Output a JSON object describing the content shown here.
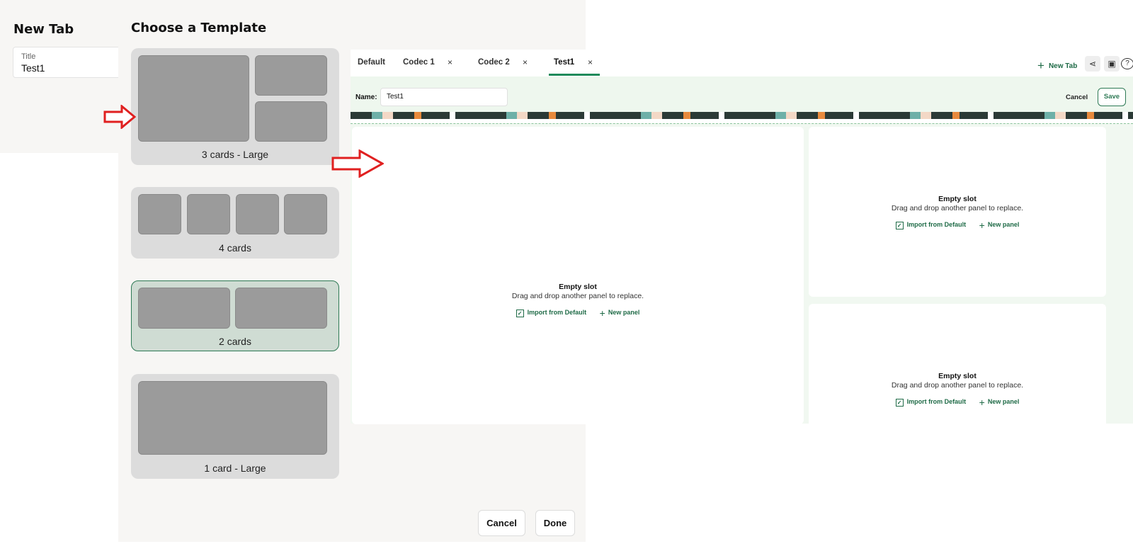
{
  "new_tab_panel": {
    "heading": "New Tab",
    "title_field": {
      "label": "Title",
      "value": "Test1"
    }
  },
  "template_chooser": {
    "heading": "Choose a Template",
    "templates": [
      {
        "caption": "3 cards - Large",
        "selected": false
      },
      {
        "caption": "4 cards",
        "selected": false
      },
      {
        "caption": "2 cards",
        "selected": true
      },
      {
        "caption": "1 card - Large",
        "selected": false
      }
    ],
    "cancel_label": "Cancel",
    "done_label": "Done"
  },
  "editor": {
    "tabs": [
      {
        "label": "Default",
        "closable": false
      },
      {
        "label": "Codec 1",
        "closable": true
      },
      {
        "label": "Codec 2",
        "closable": true
      },
      {
        "label": "Test1",
        "closable": true,
        "active": true
      }
    ],
    "close_glyph": "×",
    "new_tab_label": "New Tab",
    "name_label": "Name:",
    "name_value": "Test1",
    "cancel_label": "Cancel",
    "save_label": "Save",
    "slots": [
      {
        "title": "Empty slot",
        "description": "Drag and drop another panel to replace.",
        "import_label": "Import from Default",
        "new_panel_label": "New panel"
      },
      {
        "title": "Empty slot",
        "description": "Drag and drop another panel to replace.",
        "import_label": "Import from Default",
        "new_panel_label": "New panel"
      },
      {
        "title": "Empty slot",
        "description": "Drag and drop another panel to replace.",
        "import_label": "Import from Default",
        "new_panel_label": "New panel"
      }
    ]
  },
  "colors": {
    "accent": "#1f8a5a",
    "selected_template_bg": "#cfdcd3",
    "arrow": "#e02020"
  },
  "icons": [
    "plus-icon",
    "share-icon",
    "screen-icon",
    "help-icon",
    "import-icon",
    "close-icon",
    "arrow-right-icon"
  ]
}
